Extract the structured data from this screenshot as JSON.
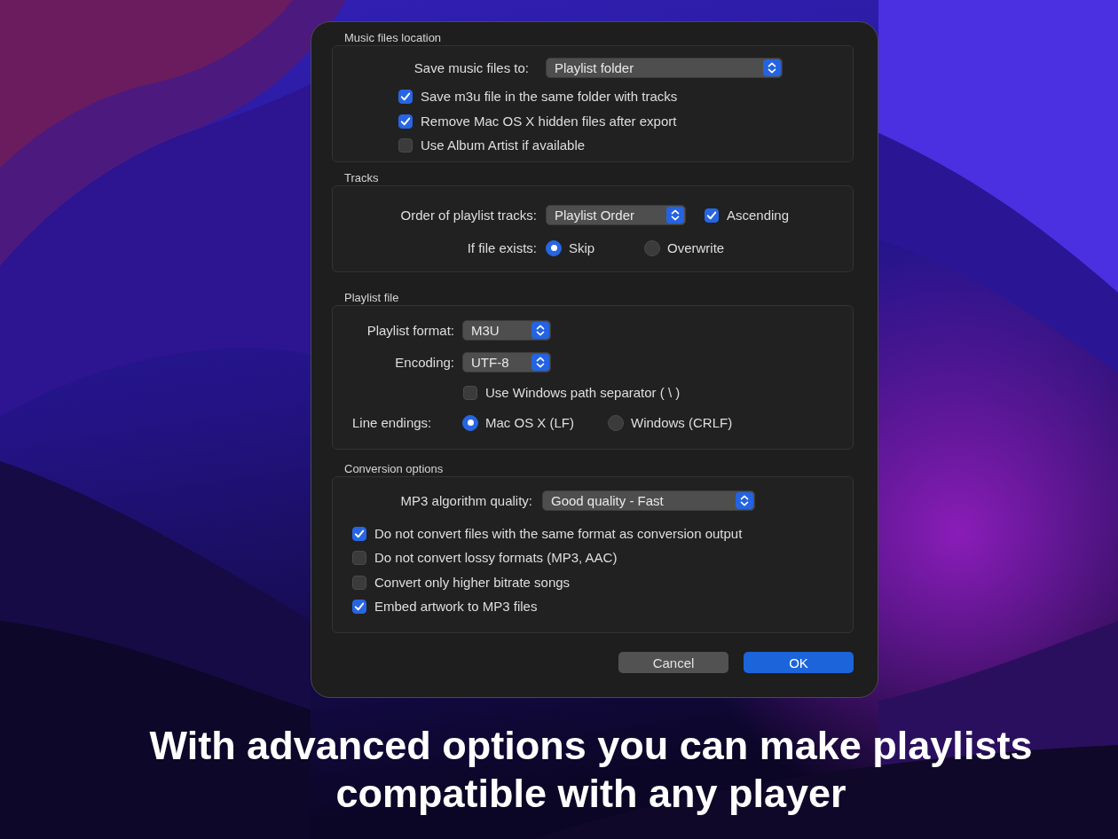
{
  "dialog": {
    "sections": [
      {
        "title": "Music files location",
        "rows": [
          {
            "kind": "popup",
            "label": "Save music files to:",
            "value": "Playlist folder"
          },
          {
            "kind": "checkbox",
            "label": "Save m3u file in the same folder with tracks",
            "checked": true
          },
          {
            "kind": "checkbox",
            "label": "Remove Mac OS X hidden files after export",
            "checked": true
          },
          {
            "kind": "checkbox",
            "label": "Use Album Artist if available",
            "checked": false
          }
        ]
      },
      {
        "title": "Tracks",
        "rows": [
          {
            "kind": "popup",
            "label": "Order of playlist tracks:",
            "value": "Playlist Order",
            "option": {
              "label": "Ascending",
              "checked": true
            }
          },
          {
            "kind": "radio",
            "label": "If file exists:",
            "options": [
              {
                "label": "Skip",
                "selected": true
              },
              {
                "label": "Overwrite",
                "selected": false
              }
            ]
          }
        ]
      },
      {
        "title": "Playlist file",
        "rows": [
          {
            "kind": "popup",
            "label": "Playlist format:",
            "value": "M3U"
          },
          {
            "kind": "popup",
            "label": "Encoding:",
            "value": "UTF-8"
          },
          {
            "kind": "checkbox",
            "label": "Use Windows path separator ( \\ )",
            "checked": false
          },
          {
            "kind": "radio",
            "label": "Line endings:",
            "options": [
              {
                "label": "Mac OS X (LF)",
                "selected": true
              },
              {
                "label": "Windows (CRLF)",
                "selected": false
              }
            ]
          }
        ]
      },
      {
        "title": "Conversion options",
        "rows": [
          {
            "kind": "popup",
            "label": "MP3 algorithm quality:",
            "value": "Good quality - Fast"
          },
          {
            "kind": "checkbox",
            "label": "Do not convert files with the same format as conversion output",
            "checked": true
          },
          {
            "kind": "checkbox",
            "label": "Do not convert lossy formats (MP3, AAC)",
            "checked": false
          },
          {
            "kind": "checkbox",
            "label": "Convert only higher bitrate songs",
            "checked": false
          },
          {
            "kind": "checkbox",
            "label": "Embed artwork to MP3 files",
            "checked": true
          }
        ]
      }
    ],
    "buttons": [
      {
        "label": "Cancel",
        "kind": "cancel"
      },
      {
        "label": "OK",
        "kind": "default"
      }
    ]
  },
  "caption": "With advanced options you can make playlists compatible with any player"
}
